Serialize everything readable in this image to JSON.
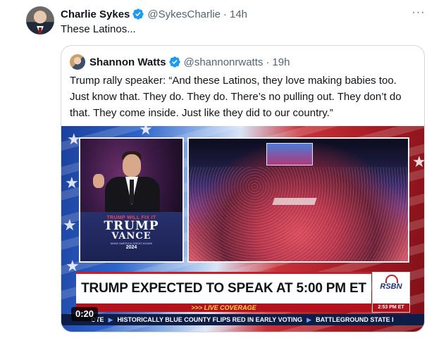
{
  "tweet": {
    "author_name": "Charlie Sykes",
    "handle": "@SykesCharlie",
    "separator": "·",
    "time": "14h",
    "text": "These Latinos...",
    "more_label": "···"
  },
  "quoted": {
    "author_name": "Shannon Watts",
    "handle": "@shannonrwatts",
    "separator": "·",
    "time": "19h",
    "text": "Trump rally speaker: “And these Latinos, they love making babies too. Just know that. They do. They do. There’s no pulling out. They don’t do that. They come inside. Just like they did to our country.”"
  },
  "video": {
    "podium_line1_a": "TRUMP ",
    "podium_line1_b": "WILL",
    "podium_line1_c": " FIX IT",
    "podium_trump": "TRUMP",
    "podium_vance": "VANCE",
    "podium_slogan": "MAKE AMERICA GREAT AGAIN!",
    "podium_year": "2024",
    "headline": "TRUMP EXPECTED TO SPEAK AT 5:00 PM ET",
    "live_label": ">>> LIVE COVERAGE",
    "network": "RSBN",
    "network_time": "2:53 PM ET",
    "ticker_items": [
      "OTE",
      "HISTORICALLY BLUE COUNTY FLIPS RED IN EARLY VOTING",
      "BATTLEGROUND STATE I"
    ],
    "timestamp": "0:20"
  },
  "colors": {
    "verified_blue": "#1d9bf0",
    "secondary_text": "#536471",
    "border": "#cfd9de",
    "news_red": "#b3121d",
    "ticker_navy": "#0e1d46"
  }
}
